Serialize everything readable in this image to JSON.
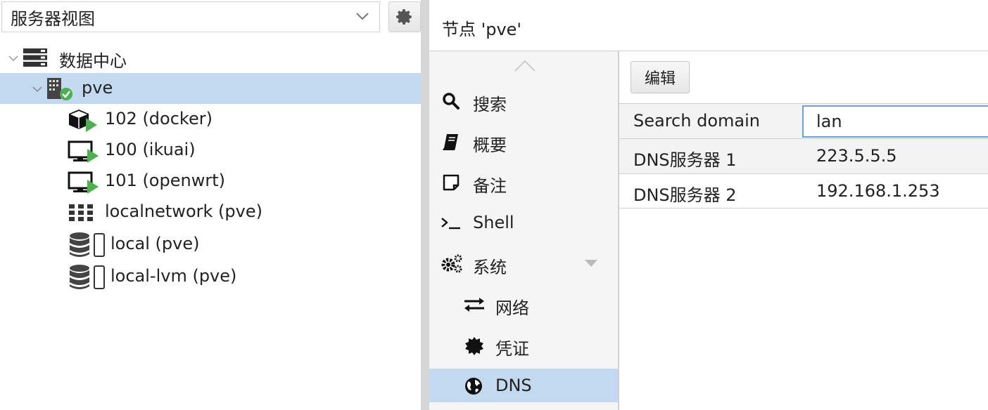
{
  "sidebar": {
    "view_selector": "服务器视图",
    "tree": [
      {
        "label": "数据中心",
        "icon": "datacenter-icon"
      },
      {
        "label": "pve",
        "icon": "node-online-icon",
        "selected": true
      },
      {
        "label": "102 (docker)",
        "icon": "container-running-icon"
      },
      {
        "label": "100 (ikuai)",
        "icon": "vm-running-icon"
      },
      {
        "label": "101 (openwrt)",
        "icon": "vm-running-icon"
      },
      {
        "label": "localnetwork (pve)",
        "icon": "network-grid-icon"
      },
      {
        "label": "local (pve)",
        "icon": "storage-icon"
      },
      {
        "label": "local-lvm (pve)",
        "icon": "storage-icon"
      }
    ]
  },
  "header": {
    "title": "节点 'pve'"
  },
  "nav": {
    "items": [
      {
        "label": "搜索",
        "icon": "search-icon"
      },
      {
        "label": "概要",
        "icon": "book-icon"
      },
      {
        "label": "备注",
        "icon": "note-icon"
      },
      {
        "label": "Shell",
        "icon": "terminal-icon"
      },
      {
        "label": "系统",
        "icon": "gears-icon"
      },
      {
        "label": "网络",
        "icon": "exchange-icon"
      },
      {
        "label": "凭证",
        "icon": "certificate-icon"
      },
      {
        "label": "DNS",
        "icon": "globe-icon",
        "selected": true
      }
    ]
  },
  "content": {
    "edit_label": "编辑",
    "rows": [
      {
        "key": "Search domain",
        "value": "lan"
      },
      {
        "key": "DNS服务器 1",
        "value": "223.5.5.5"
      },
      {
        "key": "DNS服务器 2",
        "value": "192.168.1.253"
      }
    ]
  },
  "colors": {
    "selection": "#c3d9ef",
    "running": "#4caf50",
    "focus_border": "#6aa3d6"
  }
}
